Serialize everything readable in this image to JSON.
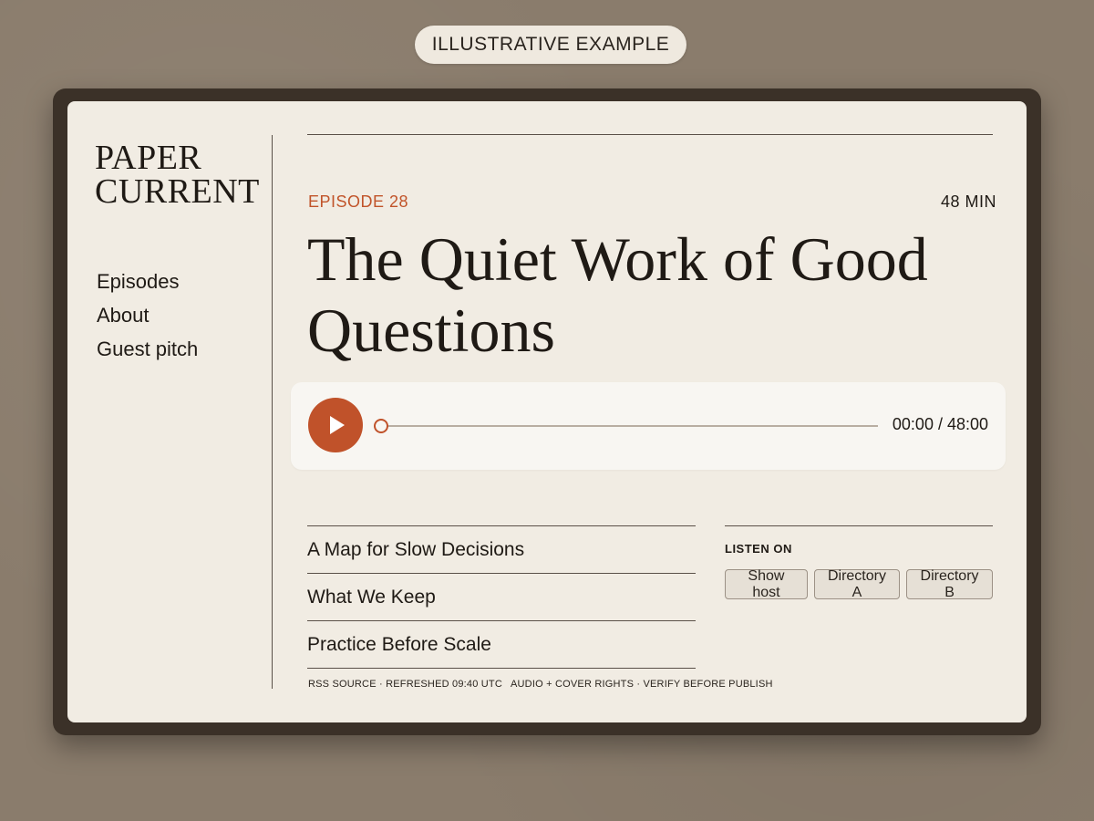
{
  "badge": {
    "label": "ILLUSTRATIVE EXAMPLE"
  },
  "brand": {
    "line1": "PAPER",
    "line2": "CURRENT"
  },
  "nav": {
    "items": [
      "Episodes",
      "About",
      "Guest pitch"
    ]
  },
  "episode": {
    "eyebrow": "EPISODE 28",
    "duration": "48 MIN",
    "title": "The Quiet Work of Good Questions"
  },
  "player": {
    "time": "00:00 / 48:00",
    "progress_fraction": 0,
    "icons": {
      "play": "play-icon"
    },
    "accent": "#c0522a"
  },
  "episode_list": [
    "A Map for Slow Decisions",
    "What We Keep",
    "Practice Before Scale"
  ],
  "listen_on": {
    "title": "LISTEN ON",
    "chips": [
      "Show host",
      "Directory A",
      "Directory B"
    ]
  },
  "footer": {
    "left": "RSS SOURCE · REFRESHED 09:40 UTC",
    "right": "AUDIO + COVER RIGHTS · VERIFY BEFORE PUBLISH"
  }
}
